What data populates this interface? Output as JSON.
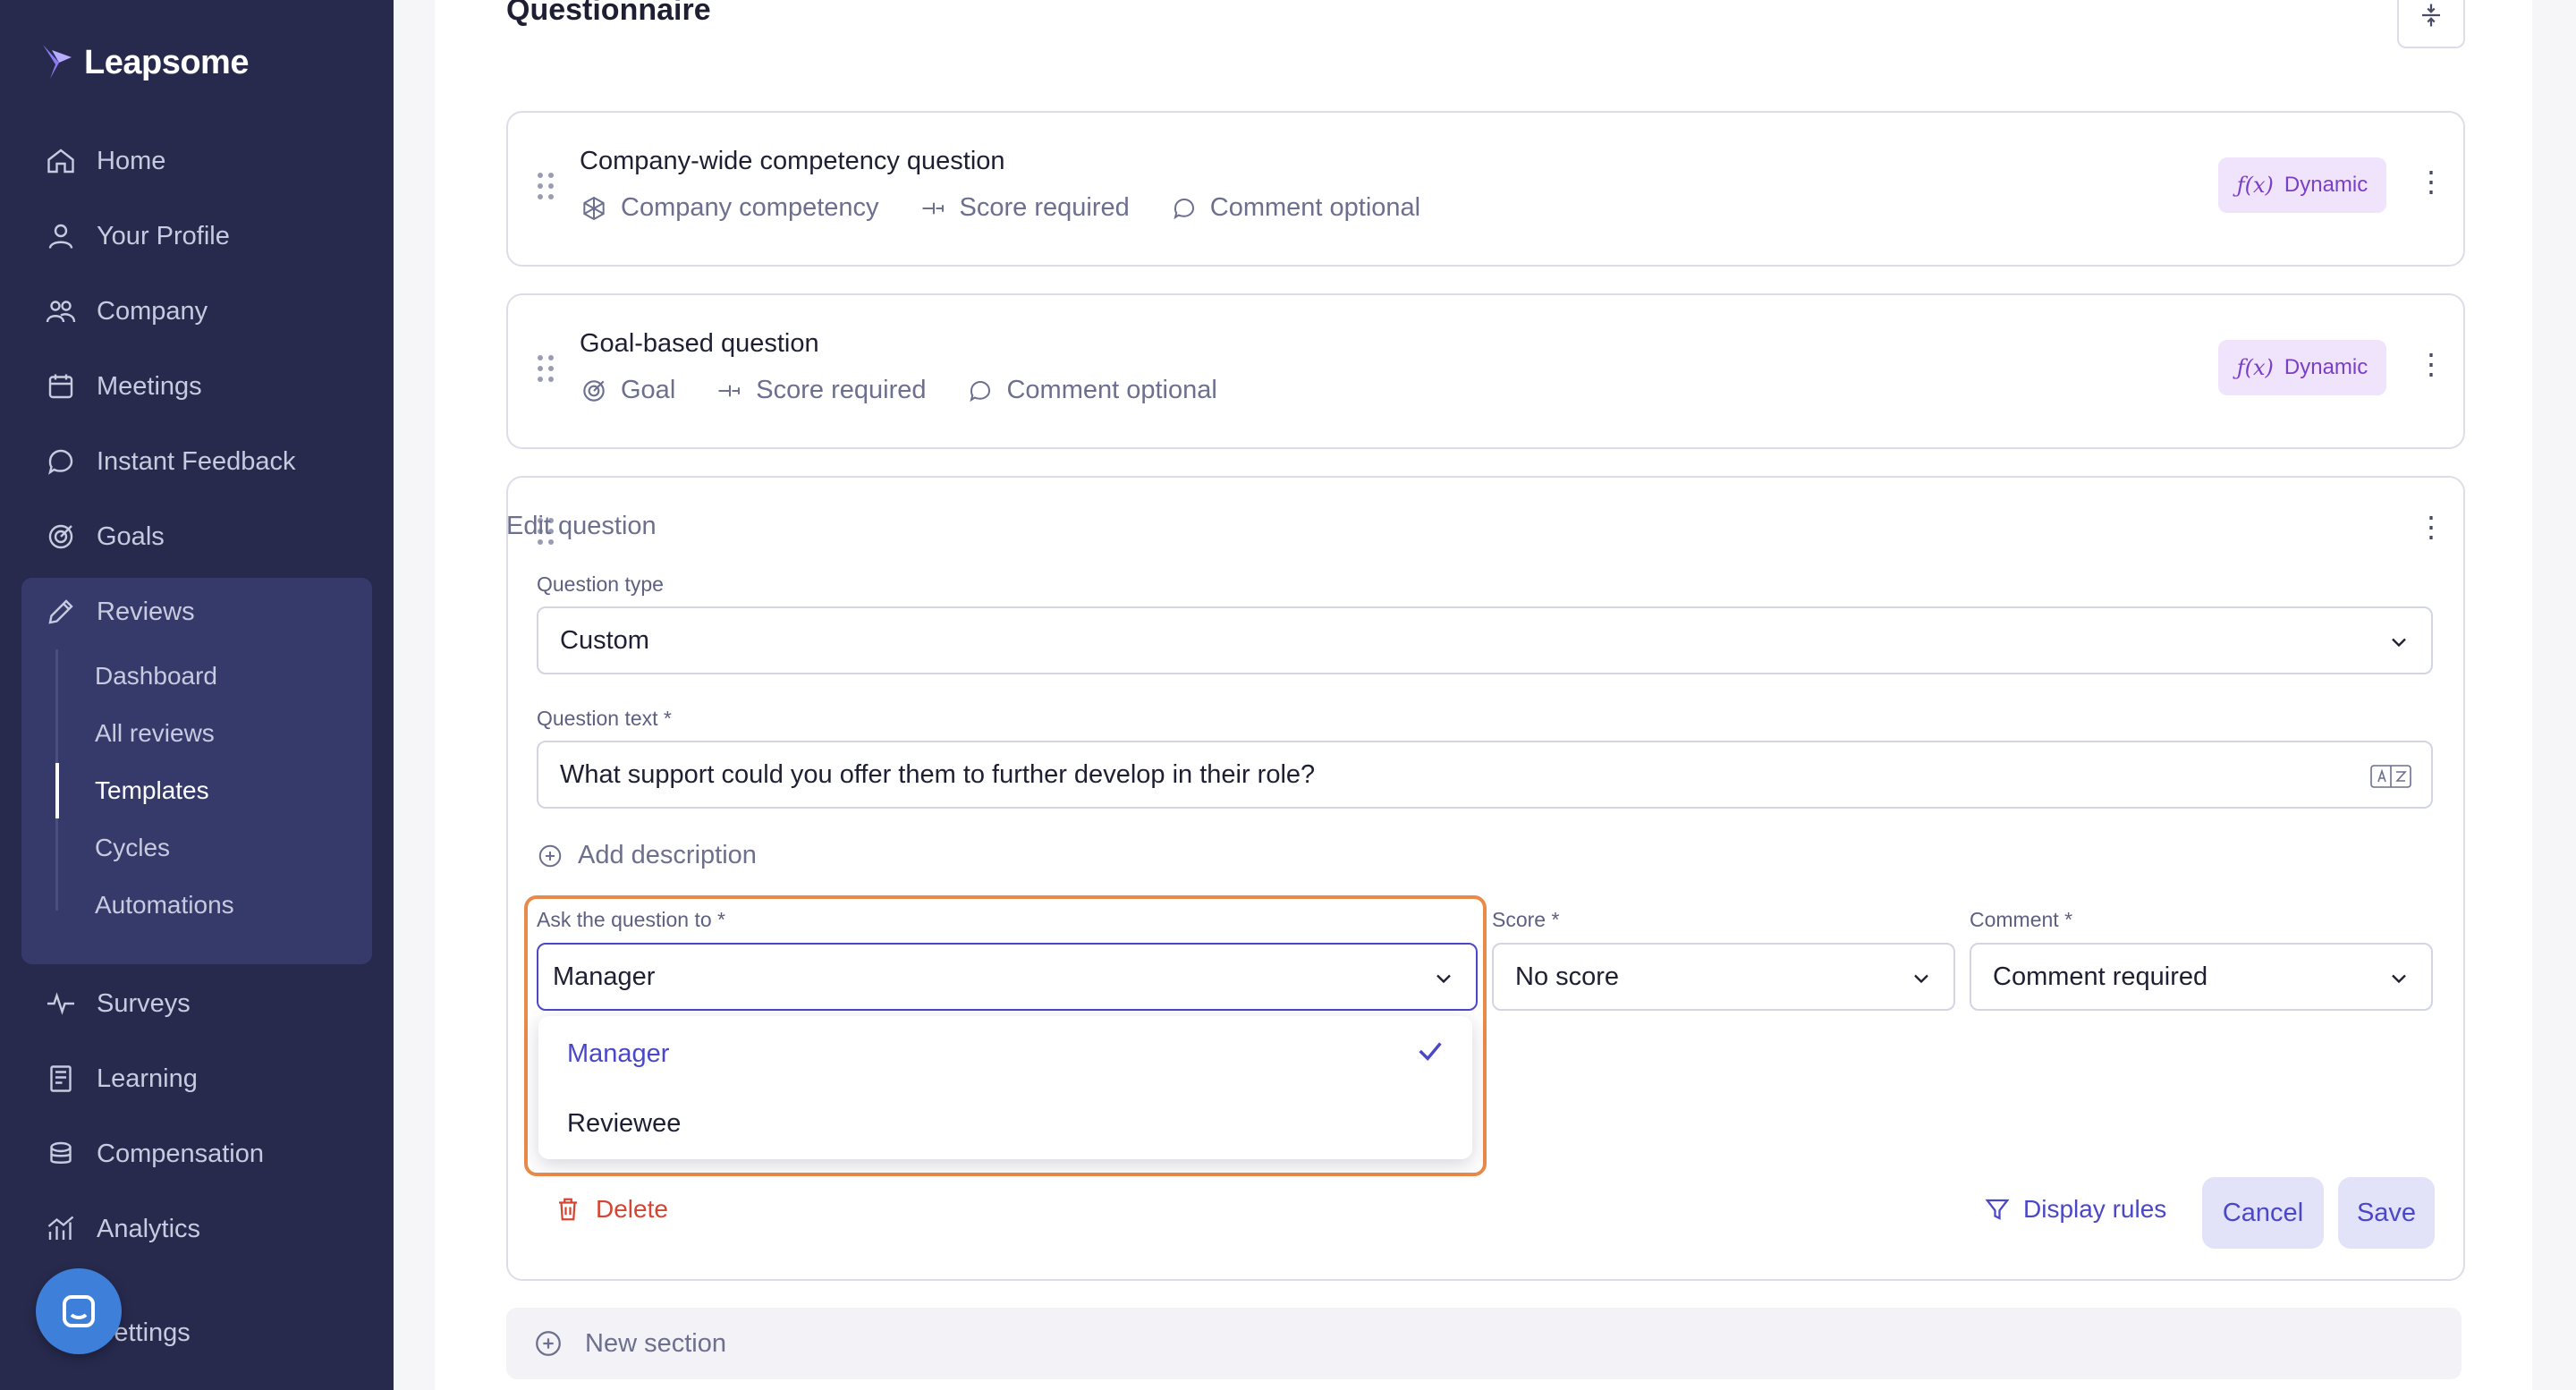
{
  "brand": {
    "name": "Leapsome"
  },
  "nav": {
    "items": [
      {
        "label": "Home",
        "icon": "home-icon"
      },
      {
        "label": "Your Profile",
        "icon": "user-icon"
      },
      {
        "label": "Company",
        "icon": "users-icon"
      },
      {
        "label": "Meetings",
        "icon": "calendar-icon"
      },
      {
        "label": "Instant Feedback",
        "icon": "chat-icon"
      },
      {
        "label": "Goals",
        "icon": "target-icon"
      },
      {
        "label": "Reviews",
        "icon": "pencil-icon"
      },
      {
        "label": "Surveys",
        "icon": "pulse-icon"
      },
      {
        "label": "Learning",
        "icon": "book-icon"
      },
      {
        "label": "Compensation",
        "icon": "coins-icon"
      },
      {
        "label": "Analytics",
        "icon": "chart-icon"
      },
      {
        "label": "Settings",
        "icon": "gear-icon"
      }
    ],
    "reviews_sub": [
      "Dashboard",
      "All reviews",
      "Templates",
      "Cycles",
      "Automations"
    ],
    "active_sub": "Templates"
  },
  "main": {
    "section_title": "Questionnaire",
    "questions": [
      {
        "title": "Company-wide competency question",
        "type": "Company competency",
        "score": "Score required",
        "comment": "Comment optional",
        "badge": "Dynamic"
      },
      {
        "title": "Goal-based question",
        "type": "Goal",
        "score": "Score required",
        "comment": "Comment optional",
        "badge": "Dynamic"
      }
    ],
    "edit": {
      "title": "Edit question",
      "question_type_label": "Question type",
      "question_type_value": "Custom",
      "question_text_label": "Question text *",
      "question_text_value": "What support could you offer them to further develop in their role?",
      "add_description": "Add description",
      "ask_label": "Ask the question to *",
      "ask_value": "Manager",
      "ask_options": [
        "Manager",
        "Reviewee"
      ],
      "score_label": "Score *",
      "score_value": "No score",
      "comment_label": "Comment *",
      "comment_value": "Comment required",
      "delete": "Delete",
      "display_rules": "Display rules",
      "cancel": "Cancel",
      "save": "Save"
    },
    "new_section": "New section"
  },
  "colors": {
    "sidebar_bg": "#272a4d",
    "accent": "#4b47c9",
    "dynamic_badge": "#7b3fc6",
    "danger": "#d64432",
    "highlight": "#e98a4b"
  }
}
